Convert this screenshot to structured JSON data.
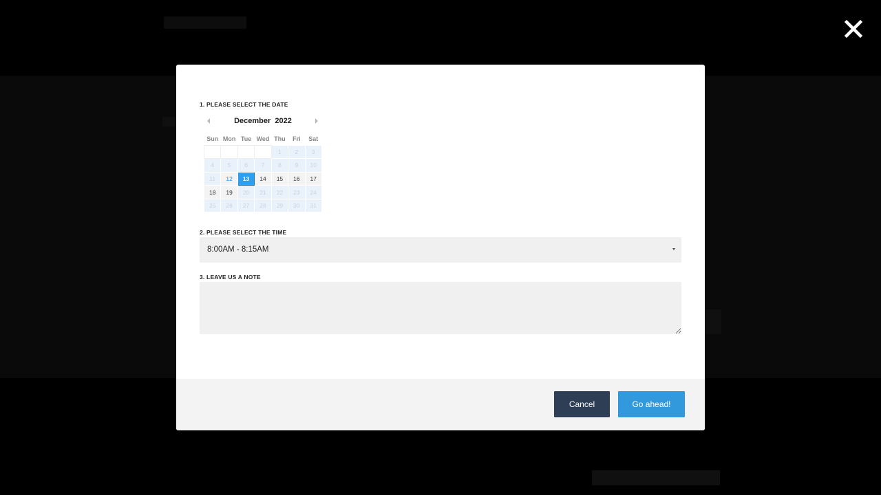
{
  "modal": {
    "date_label": "1. PLEASE SELECT THE DATE",
    "time_label": "2. PLEASE SELECT THE TIME",
    "note_label": "3. LEAVE US A NOTE",
    "calendar": {
      "month": "December",
      "year": "2022",
      "weekdays": [
        "Sun",
        "Mon",
        "Tue",
        "Wed",
        "Thu",
        "Fri",
        "Sat"
      ],
      "selected_day": "13",
      "weeks": [
        [
          {
            "d": "",
            "s": "empty"
          },
          {
            "d": "",
            "s": "empty"
          },
          {
            "d": "",
            "s": "empty"
          },
          {
            "d": "",
            "s": "empty"
          },
          {
            "d": "1",
            "s": "disabled"
          },
          {
            "d": "2",
            "s": "disabled"
          },
          {
            "d": "3",
            "s": "disabled"
          }
        ],
        [
          {
            "d": "4",
            "s": "disabled"
          },
          {
            "d": "5",
            "s": "disabled"
          },
          {
            "d": "6",
            "s": "disabled"
          },
          {
            "d": "7",
            "s": "disabled"
          },
          {
            "d": "8",
            "s": "disabled"
          },
          {
            "d": "9",
            "s": "disabled"
          },
          {
            "d": "10",
            "s": "disabled"
          }
        ],
        [
          {
            "d": "11",
            "s": "disabled"
          },
          {
            "d": "12",
            "s": "today"
          },
          {
            "d": "13",
            "s": "selected"
          },
          {
            "d": "14",
            "s": "available"
          },
          {
            "d": "15",
            "s": "available"
          },
          {
            "d": "16",
            "s": "available"
          },
          {
            "d": "17",
            "s": "available"
          }
        ],
        [
          {
            "d": "18",
            "s": "available"
          },
          {
            "d": "19",
            "s": "available"
          },
          {
            "d": "20",
            "s": "disabled"
          },
          {
            "d": "21",
            "s": "disabled"
          },
          {
            "d": "22",
            "s": "disabled"
          },
          {
            "d": "23",
            "s": "disabled"
          },
          {
            "d": "24",
            "s": "disabled"
          }
        ],
        [
          {
            "d": "25",
            "s": "disabled"
          },
          {
            "d": "26",
            "s": "disabled"
          },
          {
            "d": "27",
            "s": "disabled"
          },
          {
            "d": "28",
            "s": "disabled"
          },
          {
            "d": "29",
            "s": "disabled"
          },
          {
            "d": "30",
            "s": "disabled"
          },
          {
            "d": "31",
            "s": "disabled"
          }
        ]
      ]
    },
    "time_select": {
      "value": "8:00AM - 8:15AM"
    },
    "note": {
      "value": "",
      "placeholder": ""
    },
    "cancel_label": "Cancel",
    "go_label": "Go ahead!"
  },
  "icons": {
    "close": "close-icon",
    "prev": "chevron-left-icon",
    "next": "chevron-right-icon",
    "caret": "caret-down-icon"
  },
  "colors": {
    "accent": "#3399dd",
    "selected_day": "#2d9fee",
    "cancel_button": "#2e3e54",
    "overlay": "#000000"
  }
}
